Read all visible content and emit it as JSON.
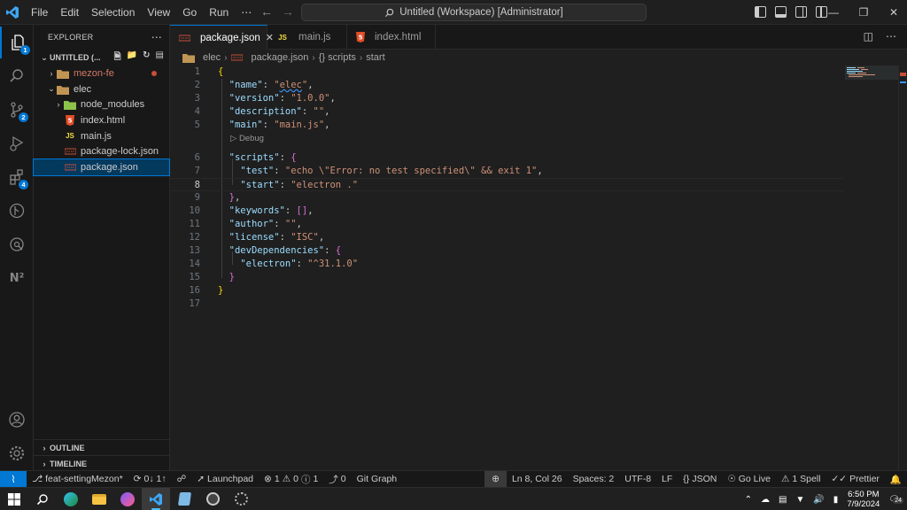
{
  "titlebar": {
    "menus": [
      "File",
      "Edit",
      "Selection",
      "View",
      "Go",
      "Run",
      "⋯"
    ],
    "command_center": "Untitled (Workspace) [Administrator]"
  },
  "activitybar": {
    "badges": {
      "explorer": "1",
      "source_control": "2",
      "extensions": "4"
    }
  },
  "sidebar": {
    "title": "EXPLORER",
    "workspace": "UNTITLED (...",
    "tree": [
      {
        "label": "mezon-fe",
        "type": "folder",
        "collapsed": true,
        "modified": true
      },
      {
        "label": "elec",
        "type": "folder",
        "collapsed": false
      },
      {
        "label": "node_modules",
        "type": "folder",
        "collapsed": true
      },
      {
        "label": "index.html",
        "type": "html"
      },
      {
        "label": "main.js",
        "type": "js"
      },
      {
        "label": "package-lock.json",
        "type": "json"
      },
      {
        "label": "package.json",
        "type": "json",
        "selected": true
      }
    ],
    "outline": "OUTLINE",
    "timeline": "TIMELINE"
  },
  "tabs": [
    {
      "label": "package.json",
      "icon": "json",
      "active": true
    },
    {
      "label": "main.js",
      "icon": "js"
    },
    {
      "label": "index.html",
      "icon": "html",
      "dirty": true
    }
  ],
  "breadcrumb": [
    "elec",
    "package.json",
    "{} scripts",
    "start"
  ],
  "editor": {
    "codelens": "▷ Debug",
    "current_line": 8,
    "line_numbers": [
      "1",
      "2",
      "3",
      "4",
      "5",
      "6",
      "7",
      "8",
      "9",
      "10",
      "11",
      "12",
      "13",
      "14",
      "15",
      "16",
      "17"
    ],
    "lines": [
      "{",
      "  \"name\": \"elec\",",
      "  \"version\": \"1.0.0\",",
      "  \"description\": \"\",",
      "  \"main\": \"main.js\",",
      "  \"scripts\": {",
      "    \"test\": \"echo \\\"Error: no test specified\\\" && exit 1\",",
      "    \"start\": \"electron .\"",
      "  },",
      "  \"keywords\": [],",
      "  \"author\": \"\",",
      "  \"license\": \"ISC\",",
      "  \"devDependencies\": {",
      "    \"electron\": \"^31.1.0\"",
      "  }",
      "}",
      ""
    ]
  },
  "statusbar": {
    "branch": "feat-settingMezon*",
    "sync": "0↓ 1↑",
    "launchpad": "Launchpad",
    "errors": "1",
    "warnings": "0",
    "info": "1",
    "ports": "0",
    "git_graph": "Git Graph",
    "cursor": "Ln 8, Col 26",
    "spaces": "Spaces: 2",
    "encoding": "UTF-8",
    "eol": "LF",
    "language": "JSON",
    "go_live": "Go Live",
    "spell": "1 Spell",
    "prettier": "Prettier"
  },
  "taskbar": {
    "time": "6:50 PM",
    "date": "7/9/2024",
    "notifications": "24"
  }
}
